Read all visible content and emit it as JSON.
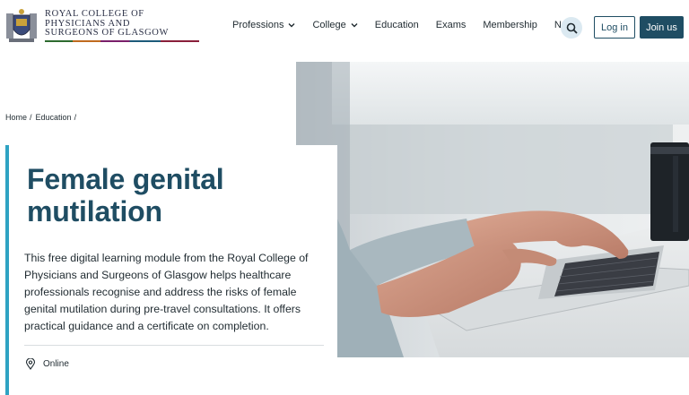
{
  "logo": {
    "line1": "ROYAL COLLEGE OF",
    "line2": "PHYSICIANS AND",
    "line3": "SURGEONS OF GLASGOW",
    "icon": "crest-icon"
  },
  "nav": {
    "items": [
      {
        "label": "Professions",
        "has_dropdown": true
      },
      {
        "label": "College",
        "has_dropdown": true
      },
      {
        "label": "Education",
        "has_dropdown": false
      },
      {
        "label": "Exams",
        "has_dropdown": false
      },
      {
        "label": "Membership",
        "has_dropdown": false
      },
      {
        "label": "News",
        "has_dropdown": false
      }
    ],
    "search_icon": "search-icon",
    "login_label": "Log in",
    "join_label": "Join us"
  },
  "breadcrumb": {
    "items": [
      "Home",
      "Education"
    ],
    "separator": "/"
  },
  "card": {
    "title": "Female genital mutilation",
    "description": "This free digital learning module from the Royal College of Physicians and Surgeons of Glasgow helps healthcare professionals recognise and address the risks of female genital mutilation during pre-travel consultations. It offers practical guidance and a certificate on completion.",
    "location_icon": "location-pin-icon",
    "location": "Online"
  },
  "colors": {
    "primary": "#1f4d63",
    "accent": "#2fa3c3",
    "search_bg": "#dbe9f1"
  }
}
